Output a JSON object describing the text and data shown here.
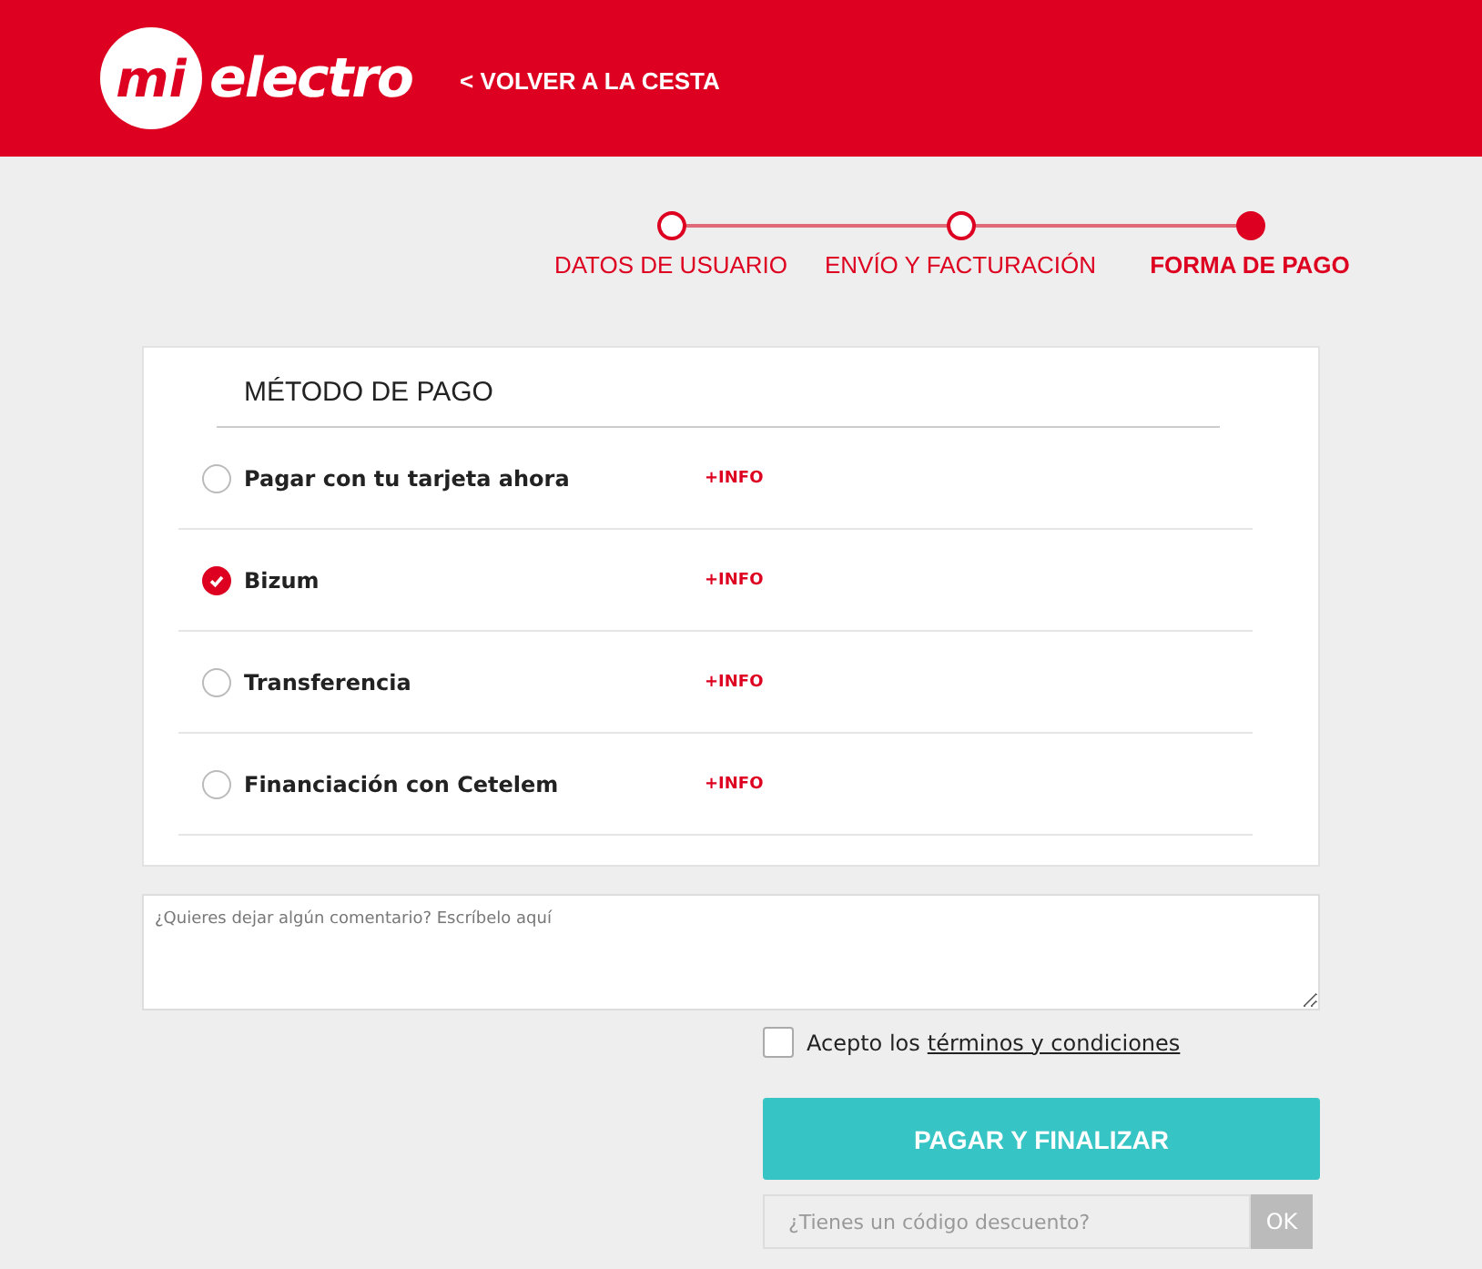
{
  "header": {
    "logo": {
      "badge": "mi",
      "wordmark": "electro"
    },
    "back_link": "< VOLVER A LA CESTA"
  },
  "steps": [
    {
      "label": "DATOS DE USUARIO",
      "selected": false
    },
    {
      "label": "ENVÍO Y FACTURACIÓN",
      "selected": false
    },
    {
      "label": "FORMA DE PAGO",
      "selected": true
    }
  ],
  "payment": {
    "title": "MÉTODO DE PAGO",
    "methods": [
      {
        "label": "Pagar con tu tarjeta ahora",
        "info": "+INFO",
        "selected": false
      },
      {
        "label": "Bizum",
        "info": "+INFO",
        "selected": true
      },
      {
        "label": "Transferencia",
        "info": "+INFO",
        "selected": false
      },
      {
        "label": "Financiación con Cetelem",
        "info": "+INFO",
        "selected": false
      }
    ]
  },
  "comment": {
    "placeholder": "¿Quieres dejar algún comentario? Escríbelo aquí"
  },
  "terms": {
    "checked": false,
    "text": "Acepto los",
    "link": "términos y condiciones"
  },
  "pay_button": "PAGAR Y FINALIZAR",
  "discount": {
    "placeholder": "¿Tienes un código descuento?",
    "button": "OK"
  }
}
